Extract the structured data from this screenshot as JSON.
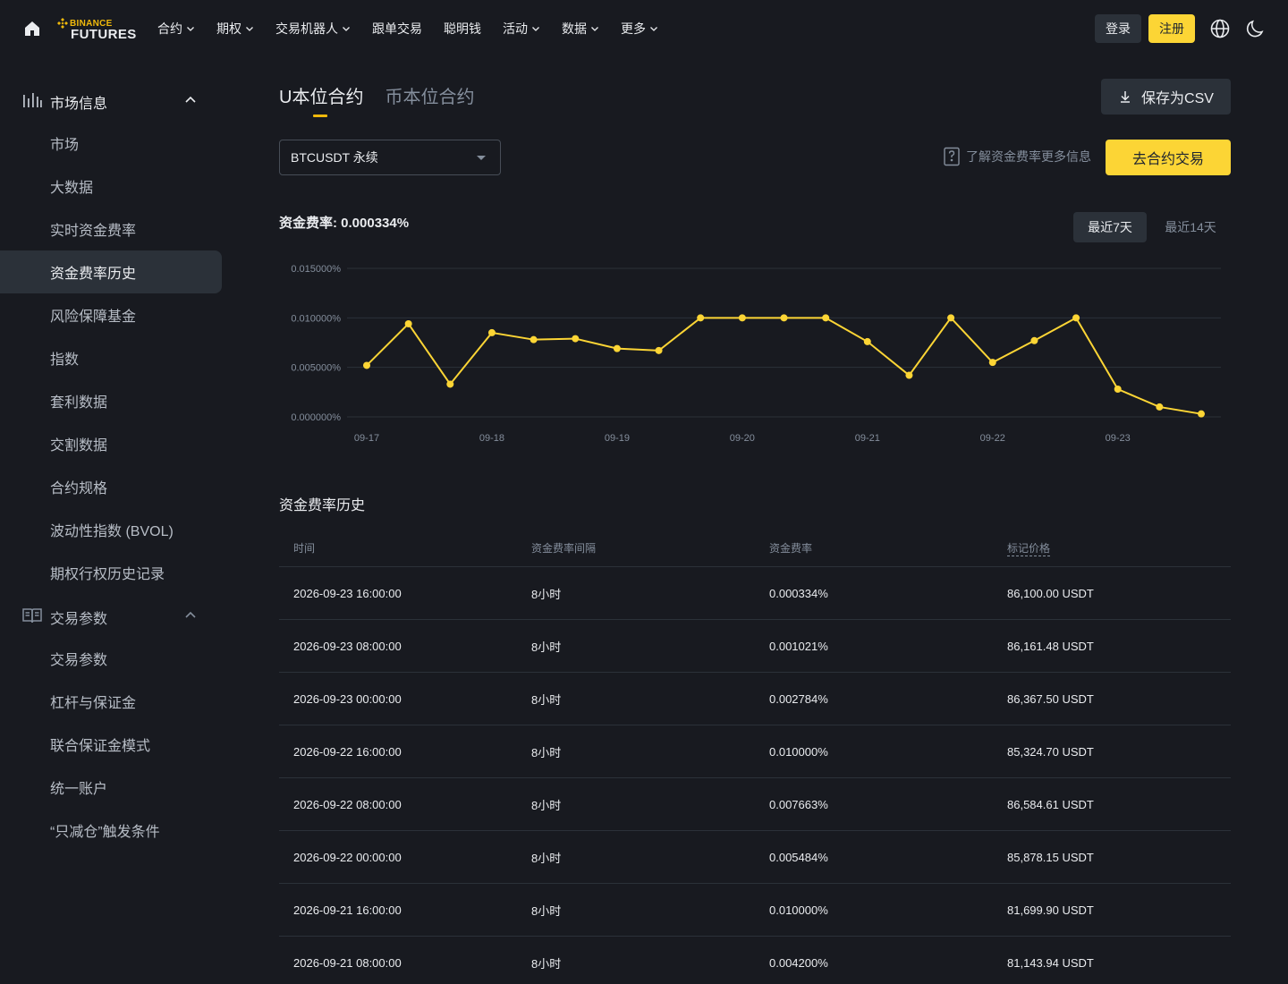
{
  "header": {
    "logo_top": "BINANCE",
    "logo_bottom": "FUTURES",
    "nav": [
      {
        "label": "合约",
        "dropdown": true
      },
      {
        "label": "期权",
        "dropdown": true
      },
      {
        "label": "交易机器人",
        "dropdown": true
      },
      {
        "label": "跟单交易",
        "dropdown": false
      },
      {
        "label": "聪明钱",
        "dropdown": false
      },
      {
        "label": "活动",
        "dropdown": true
      },
      {
        "label": "数据",
        "dropdown": true
      },
      {
        "label": "更多",
        "dropdown": true
      }
    ],
    "login": "登录",
    "register": "注册"
  },
  "sidebar": {
    "group1": {
      "label": "市场信息",
      "icon": "bar-chart-icon"
    },
    "group1_items": [
      "市场",
      "大数据",
      "实时资金费率",
      "资金费率历史",
      "风险保障基金",
      "指数",
      "套利数据",
      "交割数据",
      "合约规格",
      "波动性指数 (BVOL)",
      "期权行权历史记录"
    ],
    "active_item": "资金费率历史",
    "group2": {
      "label": "交易参数",
      "icon": "book-icon"
    },
    "group2_items": [
      "交易参数",
      "杠杆与保证金",
      "联合保证金模式",
      "统一账户",
      "“只减仓”触发条件"
    ]
  },
  "main": {
    "tabs": [
      "U本位合约",
      "币本位合约"
    ],
    "active_tab": "U本位合约",
    "csv_button": "保存为CSV",
    "symbol_select": "BTCUSDT 永续",
    "info_link": "了解资金费率更多信息",
    "trade_button": "去合约交易",
    "rate_label": "资金费率: 0.000334%",
    "range_7": "最近7天",
    "range_14": "最近14天",
    "history_title": "资金费率历史"
  },
  "chart_data": {
    "type": "line",
    "yticks": [
      "0.015000%",
      "0.010000%",
      "0.005000%",
      "0.000000%"
    ],
    "ylim": [
      0,
      0.015
    ],
    "xticks": [
      "09-17",
      "09-18",
      "09-19",
      "09-20",
      "09-21",
      "09-22",
      "09-23"
    ],
    "grid": true,
    "color": "#fcd535",
    "values": [
      0.0052,
      0.0094,
      0.0033,
      0.0085,
      0.0078,
      0.0079,
      0.0069,
      0.0067,
      0.01,
      0.01,
      0.01,
      0.01,
      0.0076,
      0.0042,
      0.01,
      0.0055,
      0.0077,
      0.01,
      0.0028,
      0.001,
      0.0003
    ]
  },
  "table": {
    "headers": [
      "时间",
      "资金费率间隔",
      "资金费率",
      "标记价格"
    ],
    "rows": [
      [
        "2026-09-23 16:00:00",
        "8小时",
        "0.000334%",
        "86,100.00 USDT"
      ],
      [
        "2026-09-23 08:00:00",
        "8小时",
        "0.001021%",
        "86,161.48 USDT"
      ],
      [
        "2026-09-23 00:00:00",
        "8小时",
        "0.002784%",
        "86,367.50 USDT"
      ],
      [
        "2026-09-22 16:00:00",
        "8小时",
        "0.010000%",
        "85,324.70 USDT"
      ],
      [
        "2026-09-22 08:00:00",
        "8小时",
        "0.007663%",
        "86,584.61 USDT"
      ],
      [
        "2026-09-22 00:00:00",
        "8小时",
        "0.005484%",
        "85,878.15 USDT"
      ],
      [
        "2026-09-21 16:00:00",
        "8小时",
        "0.010000%",
        "81,699.90 USDT"
      ],
      [
        "2026-09-21 08:00:00",
        "8小时",
        "0.004200%",
        "81,143.94 USDT"
      ]
    ]
  }
}
